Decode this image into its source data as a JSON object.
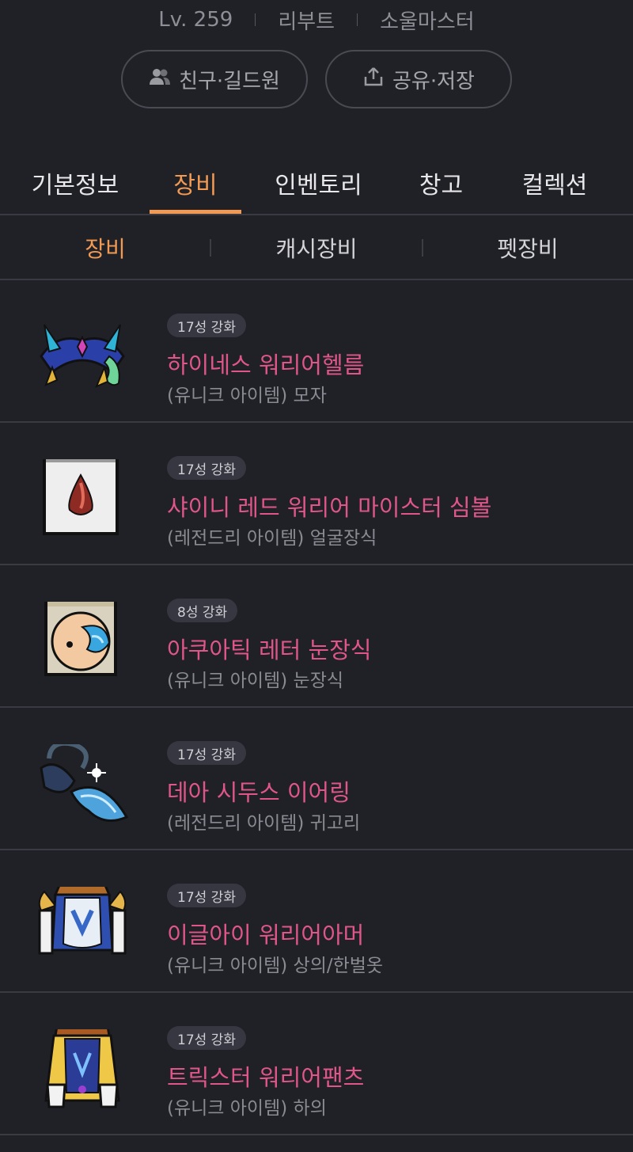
{
  "profile": {
    "level": "Lv. 259",
    "world": "리부트",
    "job": "소울마스터"
  },
  "actions": {
    "friend_label": "친구·길드원",
    "share_label": "공유·저장"
  },
  "tabs": [
    "기본정보",
    "장비",
    "인벤토리",
    "창고",
    "컬렉션"
  ],
  "active_tab": "장비",
  "subtabs": [
    "장비",
    "캐시장비",
    "펫장비"
  ],
  "active_subtab": "장비",
  "items": [
    {
      "badge": "17성 강화",
      "name": "하이네스 워리어헬름",
      "type": "(유니크 아이템) 모자",
      "icon": "helmet-icon"
    },
    {
      "badge": "17성 강화",
      "name": "샤이니 레드 워리어 마이스터 심볼",
      "type": "(레전드리 아이템) 얼굴장식",
      "icon": "symbol-icon"
    },
    {
      "badge": "8성 강화",
      "name": "아쿠아틱 레터 눈장식",
      "type": "(유니크 아이템) 눈장식",
      "icon": "eye-accessory-icon"
    },
    {
      "badge": "17성 강화",
      "name": "데아 시두스 이어링",
      "type": "(레전드리 아이템) 귀고리",
      "icon": "earring-icon"
    },
    {
      "badge": "17성 강화",
      "name": "이글아이 워리어아머",
      "type": "(유니크 아이템) 상의/한벌옷",
      "icon": "armor-icon"
    },
    {
      "badge": "17성 강화",
      "name": "트릭스터 워리어팬츠",
      "type": "(유니크 아이템) 하의",
      "icon": "pants-icon"
    }
  ],
  "colors": {
    "background": "#202127",
    "accent": "#f29a54",
    "item_name": "#e0568a"
  }
}
